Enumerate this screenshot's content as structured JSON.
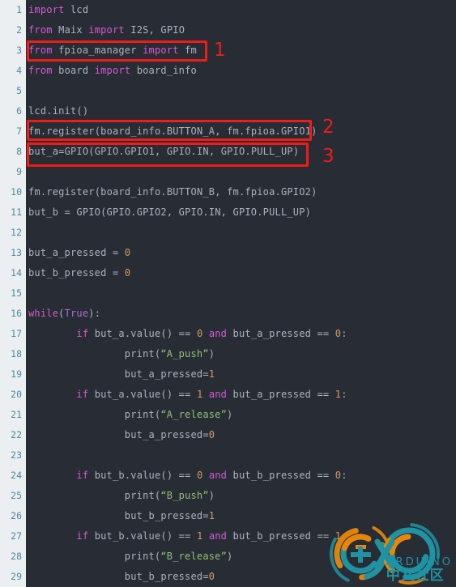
{
  "editor": {
    "language": "python",
    "background_color": "#282c34",
    "gutter_background_color": "#eceff1",
    "line_number_color": "#4b8a9b",
    "default_text_color": "#abb2bf",
    "keyword_color": "#d45bd4",
    "constant_color": "#b06bdc",
    "number_color": "#d19a66",
    "string_color": "#8cc276",
    "line_numbers": [
      "1",
      "2",
      "3",
      "4",
      "5",
      "6",
      "7",
      "8",
      "9",
      "10",
      "11",
      "12",
      "13",
      "14",
      "15",
      "16",
      "17",
      "18",
      "19",
      "20",
      "21",
      "22",
      "23",
      "24",
      "25",
      "26",
      "27",
      "28",
      "29"
    ],
    "lines": [
      {
        "n": "1",
        "text": "import lcd"
      },
      {
        "n": "2",
        "text": "from Maix import I2S, GPIO"
      },
      {
        "n": "3",
        "text": "from fpioa_manager import fm"
      },
      {
        "n": "4",
        "text": "from board import board_info"
      },
      {
        "n": "5",
        "text": ""
      },
      {
        "n": "6",
        "text": "lcd.init()"
      },
      {
        "n": "7",
        "text": "fm.register(board_info.BUTTON_A, fm.fpioa.GPIO1)"
      },
      {
        "n": "8",
        "text": "but_a=GPIO(GPIO.GPIO1, GPIO.IN, GPIO.PULL_UP)"
      },
      {
        "n": "9",
        "text": ""
      },
      {
        "n": "10",
        "text": "fm.register(board_info.BUTTON_B, fm.fpioa.GPIO2)"
      },
      {
        "n": "11",
        "text": "but_b = GPIO(GPIO.GPIO2, GPIO.IN, GPIO.PULL_UP)"
      },
      {
        "n": "12",
        "text": ""
      },
      {
        "n": "13",
        "text": "but_a_pressed = 0"
      },
      {
        "n": "14",
        "text": "but_b_pressed = 0"
      },
      {
        "n": "15",
        "text": ""
      },
      {
        "n": "16",
        "text": "while(True):"
      },
      {
        "n": "17",
        "text": "        if but_a.value() == 0 and but_a_pressed == 0:"
      },
      {
        "n": "18",
        "text": "                print(“A_push”)"
      },
      {
        "n": "19",
        "text": "                but_a_pressed=1"
      },
      {
        "n": "20",
        "text": "        if but_a.value() == 1 and but_a_pressed == 1:"
      },
      {
        "n": "21",
        "text": "                print(“A_release”)"
      },
      {
        "n": "22",
        "text": "                but_a_pressed=0"
      },
      {
        "n": "23",
        "text": ""
      },
      {
        "n": "24",
        "text": "        if but_b.value() == 0 and but_b_pressed == 0:"
      },
      {
        "n": "25",
        "text": "                print(“B_push”)"
      },
      {
        "n": "26",
        "text": "                but_b_pressed=1"
      },
      {
        "n": "27",
        "text": "        if but_b.value() == 1 and but_b_pressed == 1:"
      },
      {
        "n": "28",
        "text": "                print(“B_release”)"
      },
      {
        "n": "29",
        "text": "                but_b_pressed=0"
      }
    ]
  },
  "annotations": {
    "color": "#f01c18",
    "items": [
      {
        "label": "1",
        "target_line": "3"
      },
      {
        "label": "2",
        "target_line": "7"
      },
      {
        "label": "3",
        "target_line": "8"
      }
    ]
  },
  "watermark": {
    "brand": "ARDUINO",
    "subtitle": "中文社区",
    "color": "#1f93a3",
    "accent_color": "#e8860c"
  }
}
